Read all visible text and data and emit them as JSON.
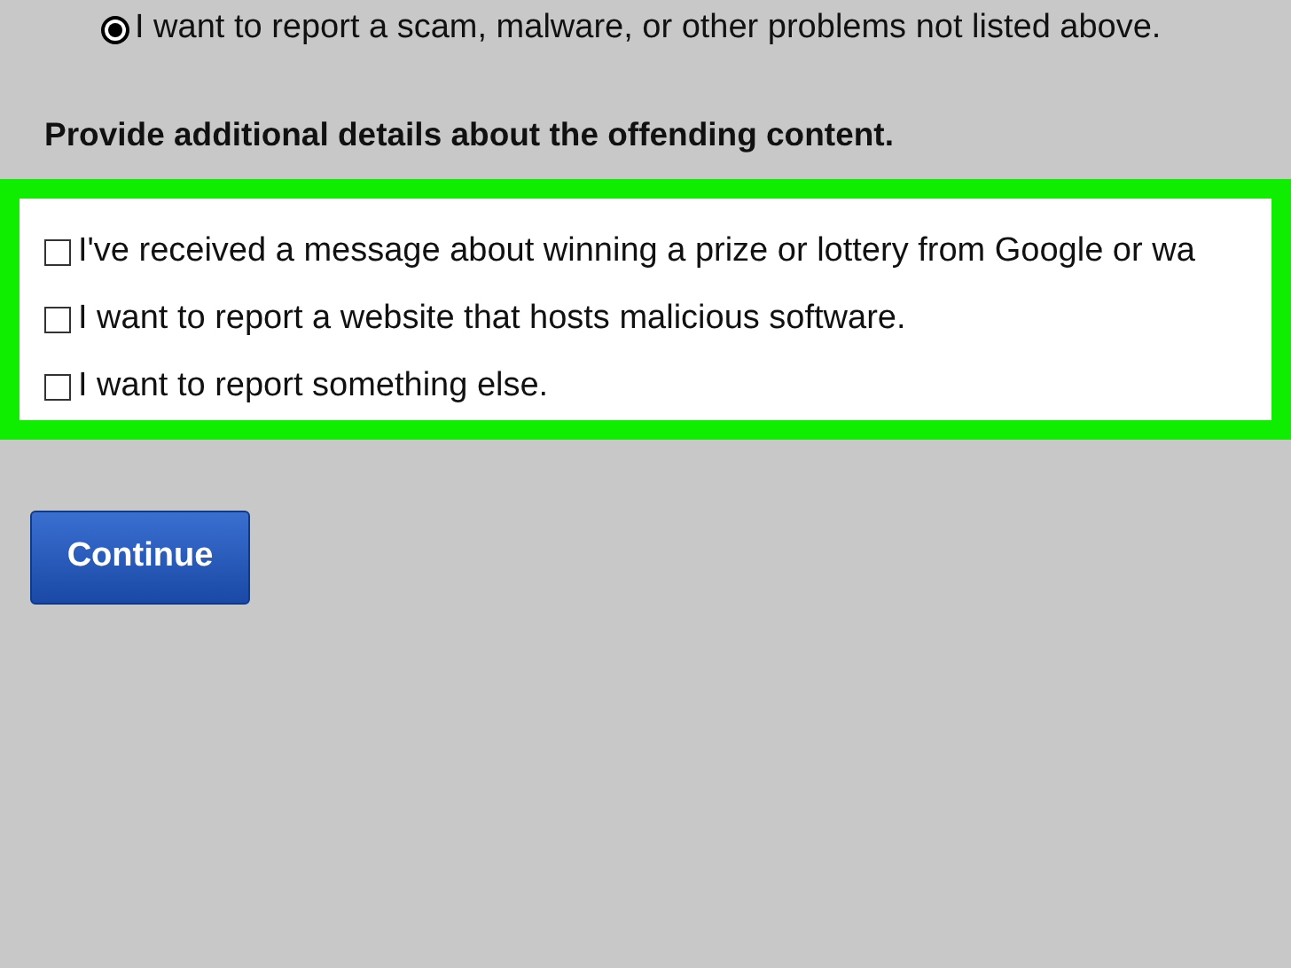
{
  "radio": {
    "label": "I want to report a scam, malware, or other problems not listed above.",
    "selected": true
  },
  "heading": "Provide additional details about the offending content.",
  "options": [
    {
      "label": "I've received a message about winning a prize or lottery from Google or wa",
      "checked": false
    },
    {
      "label": "I want to report a website that hosts malicious software.",
      "checked": false
    },
    {
      "label": "I want to report something else.",
      "checked": false
    }
  ],
  "highlight": true,
  "button": "Continue"
}
